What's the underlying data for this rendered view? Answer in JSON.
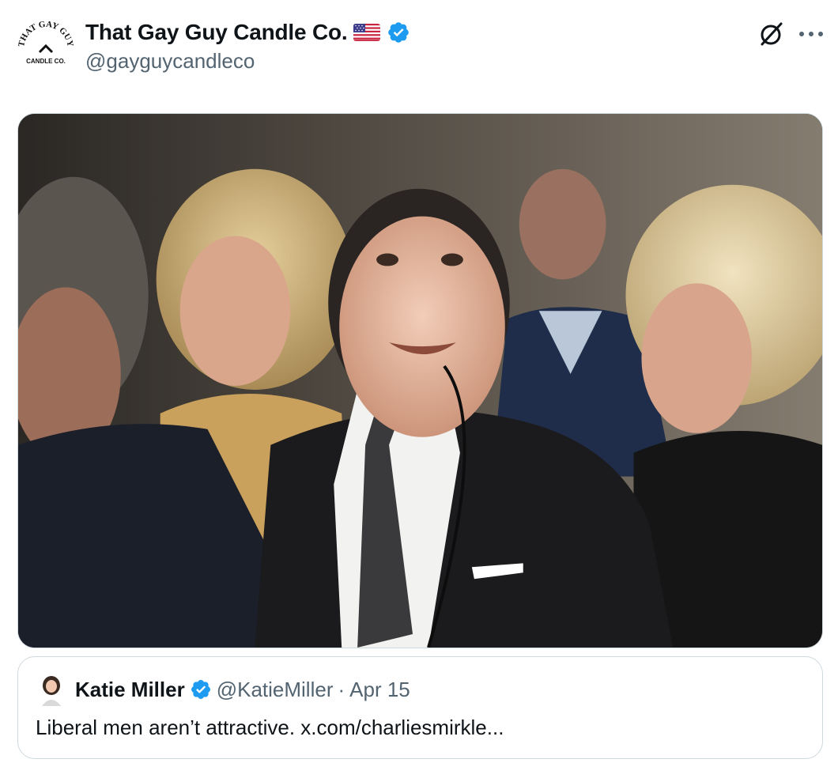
{
  "post": {
    "author": {
      "display_name": "That Gay Guy Candle Co.",
      "handle": "@gayguycandleco",
      "flag_emoji": "us-flag",
      "verified": true,
      "logo_text_top": "THAT GAY GUY",
      "logo_text_bottom": "CANDLE CO."
    },
    "actions": {
      "grok_icon": "grok-icon",
      "more_icon": "more-icon"
    },
    "media": {
      "type": "photo"
    }
  },
  "quoted_post": {
    "display_name": "Katie Miller",
    "handle": "@KatieMiller",
    "separator": "·",
    "date": "Apr 15",
    "verified": true,
    "text": "Liberal men aren’t attractive. x.com/charliesmirkle..."
  },
  "colors": {
    "verified_blue": "#1d9bf0",
    "secondary_text": "#536471",
    "primary_text": "#0f1419",
    "border": "#cfd9de"
  }
}
